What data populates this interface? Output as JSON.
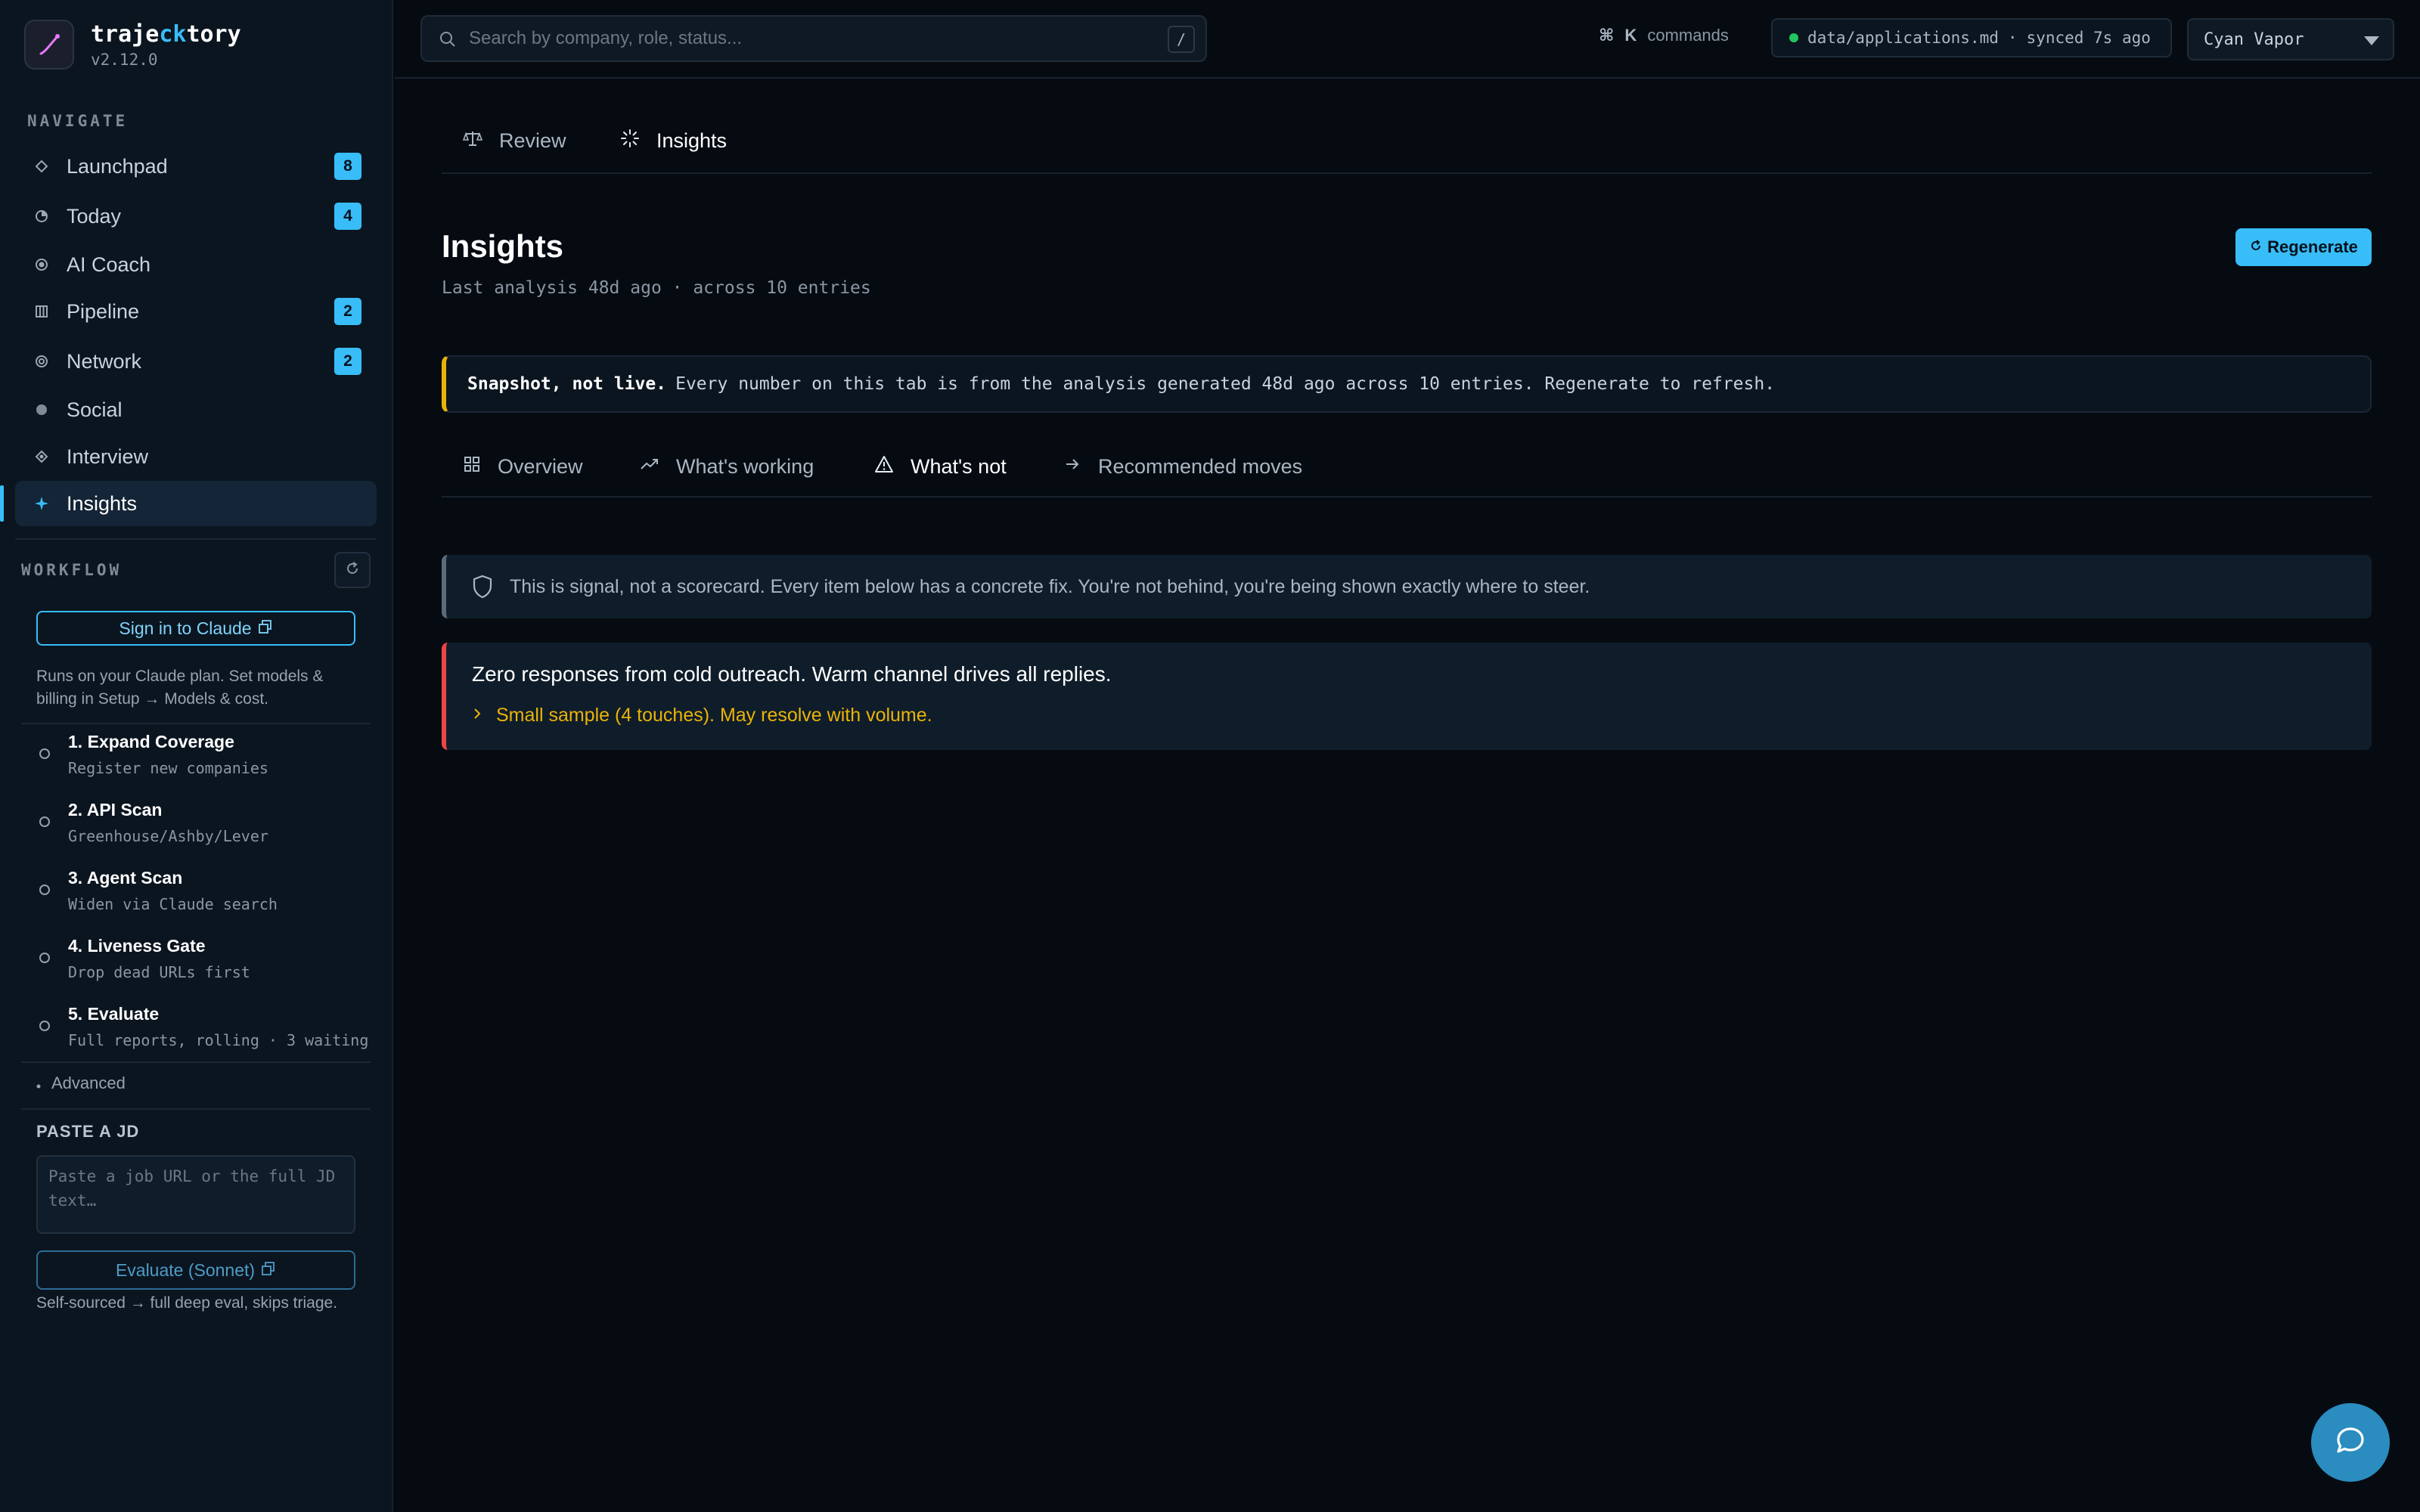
{
  "brand": {
    "name_pre": "traje",
    "name_hl": "ck",
    "name_post": "tory",
    "version": "v2.12.0"
  },
  "nav": {
    "label": "NAVIGATE",
    "items": [
      {
        "label": "Launchpad",
        "badge": "8"
      },
      {
        "label": "Today",
        "badge": "4"
      },
      {
        "label": "AI Coach",
        "badge": ""
      },
      {
        "label": "Pipeline",
        "badge": "2"
      },
      {
        "label": "Network",
        "badge": "2"
      },
      {
        "label": "Social",
        "badge": ""
      },
      {
        "label": "Interview",
        "badge": ""
      },
      {
        "label": "Insights",
        "badge": ""
      }
    ]
  },
  "workflow": {
    "label": "WORKFLOW",
    "sign_in_label": "Sign in to Claude",
    "note": "Runs on your Claude plan. Set models & billing in Setup → Models & cost.",
    "steps": [
      {
        "title": "1. Expand Coverage",
        "sub": "Register new companies"
      },
      {
        "title": "2. API Scan",
        "sub": "Greenhouse/Ashby/Lever"
      },
      {
        "title": "3. Agent Scan",
        "sub": "Widen via Claude search"
      },
      {
        "title": "4. Liveness Gate",
        "sub": "Drop dead URLs first"
      },
      {
        "title": "5. Evaluate",
        "sub": "Full reports, rolling · 3 waiting"
      }
    ],
    "advanced_label": "Advanced"
  },
  "paste_jd": {
    "label": "PASTE A JD",
    "placeholder": "Paste a job URL or the full JD text…",
    "evaluate_label": "Evaluate (Sonnet)",
    "note": "Self-sourced → full deep eval, skips triage."
  },
  "topbar": {
    "search_placeholder": "Search by company, role, status...",
    "search_shortcut": "/",
    "cmd_symbol": "⌘",
    "cmd_key": "K",
    "cmd_label": "commands",
    "sync_file": "data/applications.md",
    "sync_sep": "·",
    "sync_status": "synced 7s ago",
    "theme": "Cyan Vapor"
  },
  "top_tabs": [
    {
      "label": "Review"
    },
    {
      "label": "Insights"
    }
  ],
  "page": {
    "title": "Insights",
    "subtitle": "Last analysis 48d ago · across 10 entries",
    "regenerate_label": "Regenerate"
  },
  "snapshot": {
    "bold": "Snapshot, not live.",
    "text": "Every number on this tab is from the analysis generated 48d ago across 10 entries. Regenerate to refresh."
  },
  "sub_tabs": [
    {
      "label": "Overview"
    },
    {
      "label": "What's working"
    },
    {
      "label": "What's not"
    },
    {
      "label": "Recommended moves"
    }
  ],
  "signal_note": "This is signal, not a scorecard. Every item below has a concrete fix. You're not behind, you're being shown exactly where to steer.",
  "findings": [
    {
      "title": "Zero responses from cold outreach. Warm channel drives all replies.",
      "note": "Small sample (4 touches). May resolve with volume."
    }
  ],
  "colors": {
    "accent": "#38bdf8",
    "warning": "#eab308",
    "danger": "#ef4444",
    "success": "#22c55e"
  }
}
